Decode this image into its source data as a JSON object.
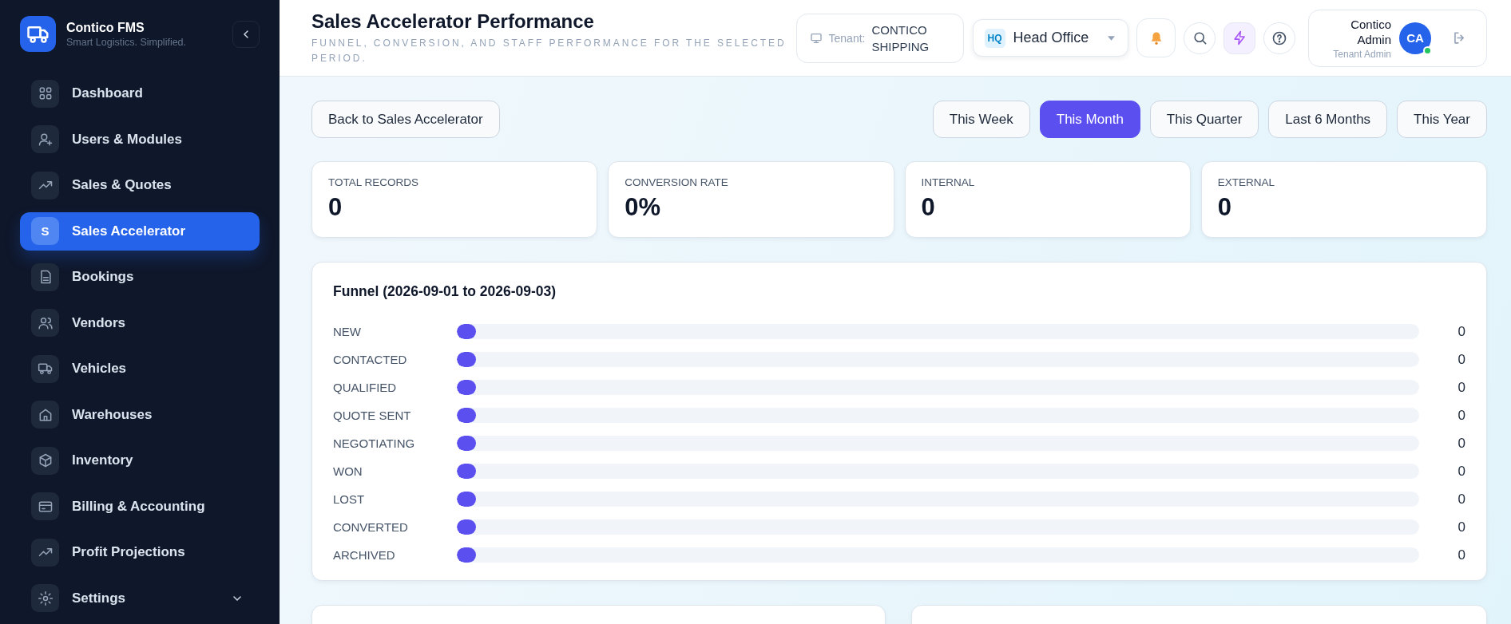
{
  "brand": {
    "name": "Contico FMS",
    "tagline": "Smart Logistics. Simplified."
  },
  "sidebar": {
    "items": [
      {
        "label": "Dashboard",
        "selected": false
      },
      {
        "label": "Users & Modules",
        "selected": false
      },
      {
        "label": "Sales & Quotes",
        "selected": false
      },
      {
        "label": "Sales Accelerator",
        "selected": true,
        "icon_text": "S"
      },
      {
        "label": "Bookings",
        "selected": false
      },
      {
        "label": "Vendors",
        "selected": false
      },
      {
        "label": "Vehicles",
        "selected": false
      },
      {
        "label": "Warehouses",
        "selected": false
      },
      {
        "label": "Inventory",
        "selected": false
      },
      {
        "label": "Billing & Accounting",
        "selected": false
      },
      {
        "label": "Profit Projections",
        "selected": false
      },
      {
        "label": "Settings",
        "selected": false,
        "expanded": false
      }
    ]
  },
  "header": {
    "title": "Sales Accelerator Performance",
    "subtitle": "FUNNEL, CONVERSION, AND STAFF PERFORMANCE FOR THE SELECTED PERIOD.",
    "tenant": {
      "label": "Tenant:",
      "value": "CONTICO SHIPPING"
    },
    "branch": {
      "badge": "HQ",
      "name": "Head Office"
    },
    "user": {
      "name": "Contico Admin",
      "role": "Tenant Admin",
      "initials": "CA",
      "online": true
    }
  },
  "back_button": "Back to Sales Accelerator",
  "periods": [
    {
      "label": "This Week",
      "selected": false
    },
    {
      "label": "This Month",
      "selected": true
    },
    {
      "label": "This Quarter",
      "selected": false
    },
    {
      "label": "Last 6 Months",
      "selected": false
    },
    {
      "label": "This Year",
      "selected": false
    }
  ],
  "stats": [
    {
      "label": "TOTAL RECORDS",
      "value": "0"
    },
    {
      "label": "CONVERSION RATE",
      "value": "0%"
    },
    {
      "label": "INTERNAL",
      "value": "0"
    },
    {
      "label": "EXTERNAL",
      "value": "0"
    }
  ],
  "funnel": {
    "title": "Funnel (2026-09-01 to 2026-09-03)",
    "stages": [
      {
        "label": "NEW",
        "level": 0,
        "count": "0"
      },
      {
        "label": "CONTACTED",
        "level": 0,
        "count": "0"
      },
      {
        "label": "QUALIFIED",
        "level": 0,
        "count": "0"
      },
      {
        "label": "QUOTE SENT",
        "level": 0,
        "count": "0"
      },
      {
        "label": "NEGOTIATING",
        "level": 0,
        "count": "0"
      },
      {
        "label": "WON",
        "level": 0,
        "count": "0"
      },
      {
        "label": "LOST",
        "level": 0,
        "count": "0"
      },
      {
        "label": "CONVERTED",
        "level": 0,
        "count": "0"
      },
      {
        "label": "ARCHIVED",
        "level": 0,
        "count": "0"
      }
    ]
  }
}
